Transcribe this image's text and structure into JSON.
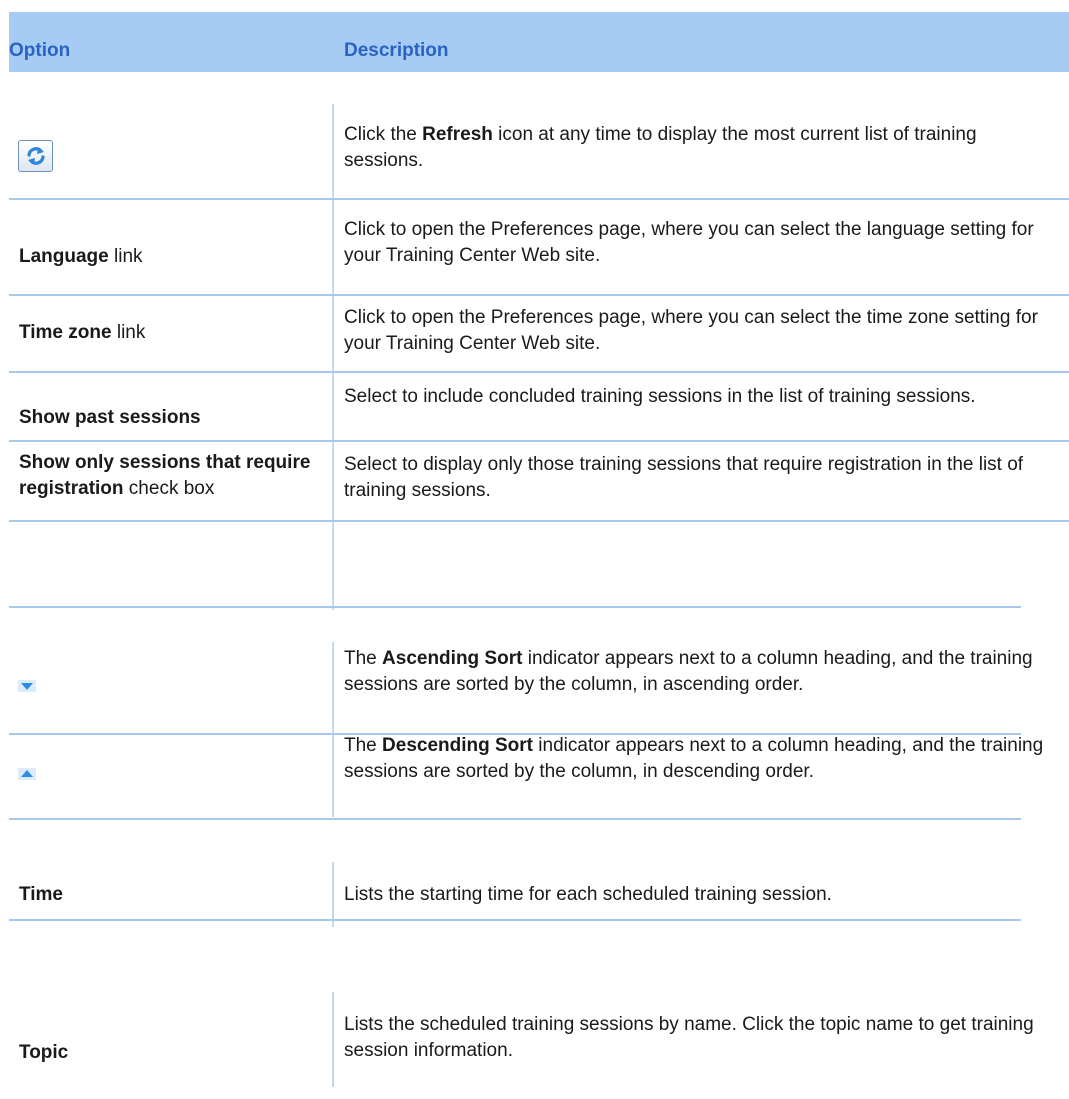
{
  "header": {
    "option": "Option",
    "description": "Description"
  },
  "rows": {
    "refresh": {
      "icon": "refresh-icon",
      "desc_pre": "Click the ",
      "desc_bold": "Refresh",
      "desc_post": " icon at any time to display the most current list of training sessions."
    },
    "language": {
      "opt_bold": "Language",
      "opt_rest": " link",
      "desc": "Click to open the Preferences page, where you can select the language setting for your Training Center Web site."
    },
    "timezone": {
      "opt_bold": "Time zone",
      "opt_rest": " link",
      "desc": "Click to open the Preferences page, where you can select the time zone setting for your Training Center Web site."
    },
    "past": {
      "opt_bold": "Show past sessions",
      "desc": "Select to include concluded training sessions in the list of training sessions."
    },
    "registration": {
      "opt_bold": "Show only sessions that require registration",
      "opt_rest": " check box",
      "desc": "Select to display only those training sessions that require registration in the list of training sessions."
    },
    "ascending": {
      "icon": "sort-down-icon",
      "desc_pre": "The ",
      "desc_bold": "Ascending Sort",
      "desc_post": " indicator appears next to a column heading, and the training sessions are sorted by the column, in ascending order."
    },
    "descending": {
      "icon": "sort-up-icon",
      "desc_pre": "The ",
      "desc_bold": "Descending Sort",
      "desc_post": " indicator appears next to a column heading, and the training sessions are sorted by the column, in descending order."
    },
    "time": {
      "opt_bold": "Time",
      "desc": "Lists the starting time for each scheduled training session."
    },
    "topic": {
      "opt_bold": "Topic",
      "desc": "Lists the scheduled training sessions by name. Click the topic name to get training session information."
    }
  },
  "colors": {
    "header_bg": "#a6cbf5",
    "header_text": "#2a64c0",
    "rule": "#a8c8ee",
    "sort_icon": "#2e8de0"
  }
}
